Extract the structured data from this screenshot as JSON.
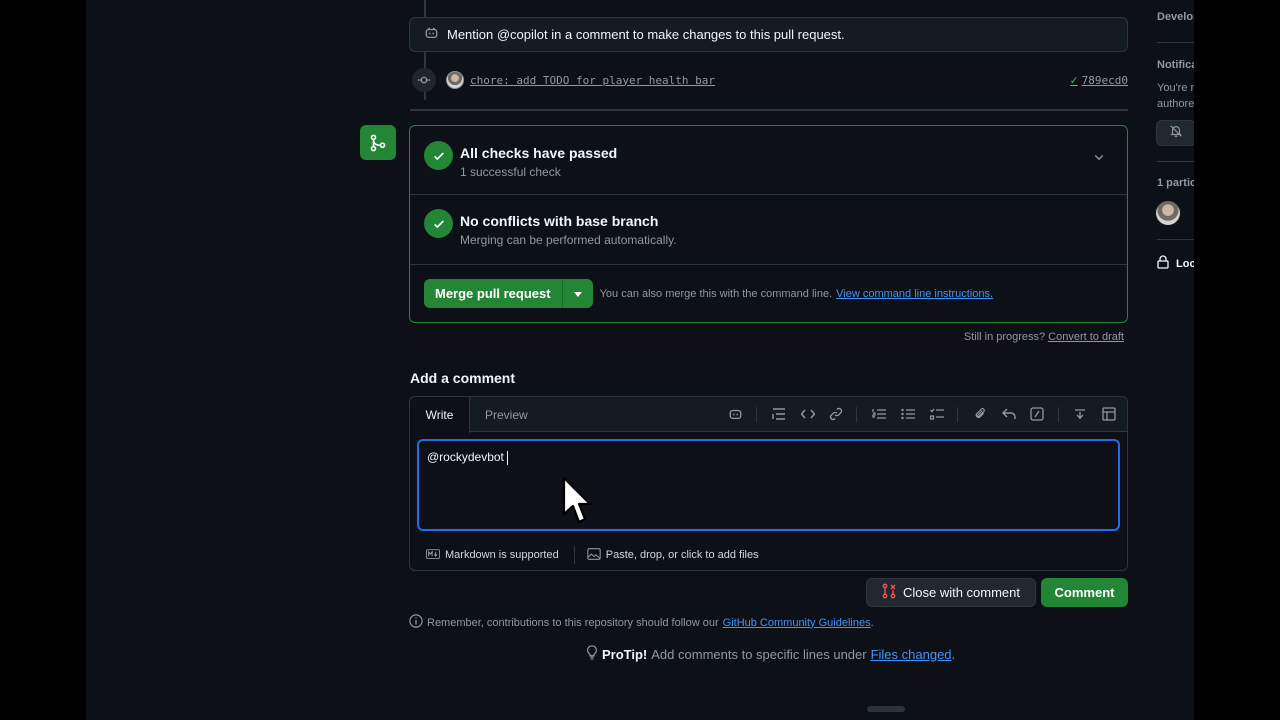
{
  "copilot_banner": {
    "text": "Mention @copilot in a comment to make changes to this pull request."
  },
  "commit": {
    "message": "chore: add TODO for player health bar",
    "sha": "789ecd0"
  },
  "checks": [
    {
      "title": "All checks have passed",
      "subtitle": "1 successful check"
    },
    {
      "title": "No conflicts with base branch",
      "subtitle": "Merging can be performed automatically."
    }
  ],
  "merge": {
    "button_label": "Merge pull request",
    "hint_text": "You can also merge this with the command line.",
    "hint_link": "View command line instructions."
  },
  "draft": {
    "prefix": "Still in progress?",
    "link": "Convert to draft"
  },
  "comment": {
    "title": "Add a comment",
    "tabs": [
      "Write",
      "Preview"
    ],
    "value": "@rockydevbot",
    "markdown_label": "Markdown is supported",
    "files_label": "Paste, drop, or click to add files",
    "close_label": "Close with comment",
    "submit_label": "Comment"
  },
  "guidelines": {
    "text": "Remember, contributions to this repository should follow our",
    "link": "GitHub Community Guidelines",
    "suffix": "."
  },
  "protip": {
    "bold": "ProTip!",
    "text": "Add comments to specific lines under",
    "link": "Files changed",
    "suffix": "."
  },
  "sidebar": {
    "development": "Develop",
    "notifications": "Notifica",
    "notif_line1": "You're r",
    "notif_line2": "authore",
    "participants": "1 partic",
    "lock": "Loc"
  },
  "colors": {
    "accent_green": "#238636",
    "link_blue": "#4493f8",
    "focus_blue": "#1f6feb",
    "close_red": "#f85149"
  }
}
